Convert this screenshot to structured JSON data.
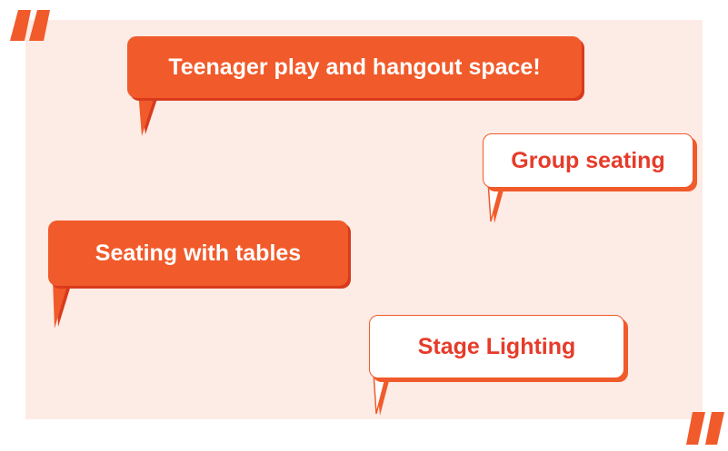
{
  "decor": {
    "open_quote_icon": "open-quote-icon",
    "close_quote_icon": "close-quote-icon",
    "accent_color": "#f15a2a",
    "text_color": "#e63b2a",
    "background_color": "#fdebe5"
  },
  "bubbles": [
    {
      "text": "Teenager play and hangout space!",
      "style": "filled"
    },
    {
      "text": "Group seating",
      "style": "outline"
    },
    {
      "text": "Seating with tables",
      "style": "filled"
    },
    {
      "text": "Stage Lighting",
      "style": "outline"
    }
  ]
}
